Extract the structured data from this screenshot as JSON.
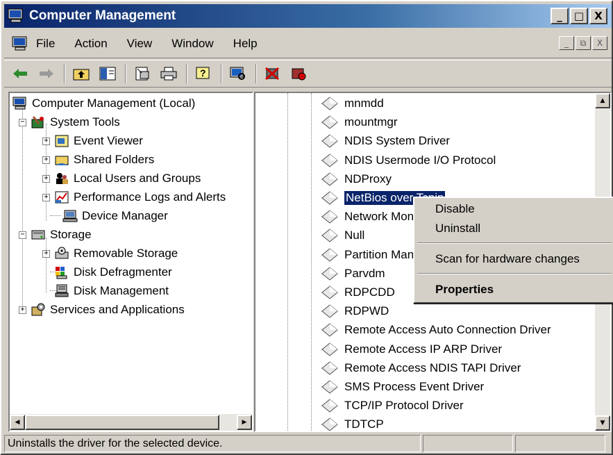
{
  "window": {
    "title": "Computer Management",
    "caption_minimize": "_",
    "caption_maximize": "□",
    "caption_close": "X"
  },
  "menubar": {
    "items": [
      "File",
      "Action",
      "View",
      "Window",
      "Help"
    ],
    "mdi_minimize": "_",
    "mdi_restore": "⧉",
    "mdi_close": "X"
  },
  "toolbar": {
    "buttons": [
      "back-icon",
      "forward-icon",
      "up-folder-icon",
      "show-hide-tree-icon",
      "properties-icon",
      "print-icon",
      "help-icon",
      "scan-hardware-icon",
      "uninstall-icon",
      "disable-icon"
    ]
  },
  "tree": {
    "root": "Computer Management (Local)",
    "system_tools": "System Tools",
    "event_viewer": "Event Viewer",
    "shared_folders": "Shared Folders",
    "local_users": "Local Users and Groups",
    "perf_logs": "Performance Logs and Alerts",
    "device_manager": "Device Manager",
    "storage": "Storage",
    "removable_storage": "Removable Storage",
    "disk_defrag": "Disk Defragmenter",
    "disk_mgmt": "Disk Management",
    "services_apps": "Services and Applications",
    "expander_minus": "−",
    "expander_plus": "+"
  },
  "devices": [
    "mnmdd",
    "mountmgr",
    "NDIS System Driver",
    "NDIS Usermode I/O Protocol",
    "NDProxy",
    "NetBios over Tcpip",
    "Network Monitor Driver",
    "Null",
    "Partition Manager",
    "Parvdm",
    "RDPCDD",
    "RDPWD",
    "Remote Access Auto Connection Driver",
    "Remote Access IP ARP Driver",
    "Remote Access NDIS TAPI Driver",
    "SMS Process Event Driver",
    "TCP/IP Protocol Driver",
    "TDTCP"
  ],
  "context_menu": {
    "disable": "Disable",
    "uninstall": "Uninstall",
    "scan": "Scan for hardware changes",
    "properties": "Properties"
  },
  "statusbar": {
    "message": "Uninstalls the driver for the selected device."
  },
  "colors": {
    "title_active": "#0a246a",
    "face": "#d4d0c8",
    "selection": "#0a246a"
  }
}
